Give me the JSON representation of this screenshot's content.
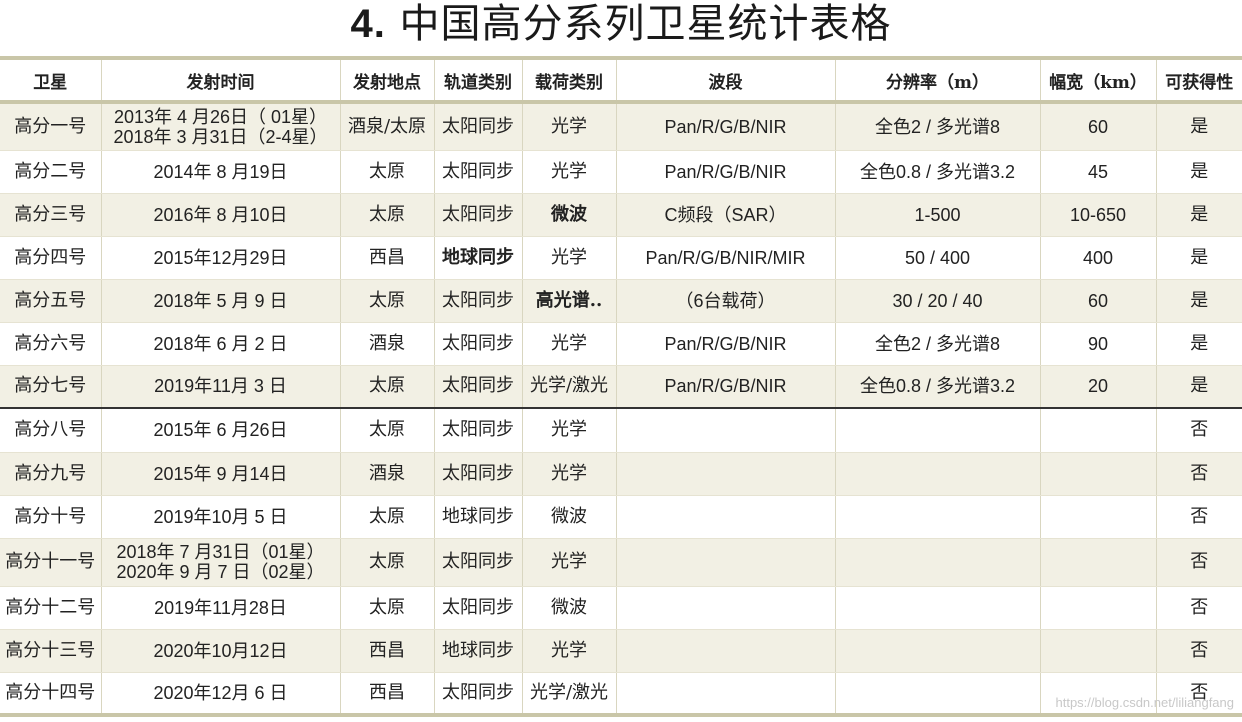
{
  "title_num": "4.",
  "title_text": "中国高分系列卫星统计表格",
  "headers": [
    "卫星",
    "发射时间",
    "发射地点",
    "轨道类别",
    "载荷类别",
    "波段",
    "分辨率（m）",
    "幅宽（km）",
    "可获得性"
  ],
  "rows": [
    {
      "name": "高分一号",
      "date": [
        "2013年 4 月26日（ 01星）",
        "2018年 3 月31日（2-4星）"
      ],
      "site": "酒泉/太原",
      "orbit": "太阳同步",
      "payload": "光学",
      "band": "Pan/R/G/B/NIR",
      "res": "全色2 / 多光谱8",
      "width": "60",
      "avail": "是"
    },
    {
      "name": "高分二号",
      "date": [
        "2014年 8 月19日"
      ],
      "site": "太原",
      "orbit": "太阳同步",
      "payload": "光学",
      "band": "Pan/R/G/B/NIR",
      "res": "全色0.8 / 多光谱3.2",
      "width": "45",
      "avail": "是"
    },
    {
      "name": "高分三号",
      "date": [
        "2016年 8 月10日"
      ],
      "site": "太原",
      "orbit": "太阳同步",
      "payload": "微波",
      "band": "C频段（SAR）",
      "res": "1-500",
      "width": "10-650",
      "avail": "是"
    },
    {
      "name": "高分四号",
      "date": [
        "2015年12月29日"
      ],
      "site": "西昌",
      "orbit": "地球同步",
      "payload": "光学",
      "band": "Pan/R/G/B/NIR/MIR",
      "res": "50 / 400",
      "width": "400",
      "avail": "是"
    },
    {
      "name": "高分五号",
      "date": [
        "2018年 5 月 9 日"
      ],
      "site": "太原",
      "orbit": "太阳同步",
      "payload": "高光谱..",
      "band": "（6台载荷）",
      "res": "30 / 20 / 40",
      "width": "60",
      "avail": "是"
    },
    {
      "name": "高分六号",
      "date": [
        "2018年 6 月 2 日"
      ],
      "site": "酒泉",
      "orbit": "太阳同步",
      "payload": "光学",
      "band": "Pan/R/G/B/NIR",
      "res": "全色2 / 多光谱8",
      "width": "90",
      "avail": "是"
    },
    {
      "name": "高分七号",
      "date": [
        "2019年11月 3 日"
      ],
      "site": "太原",
      "orbit": "太阳同步",
      "payload": "光学/激光",
      "band": "Pan/R/G/B/NIR",
      "res": "全色0.8 / 多光谱3.2",
      "width": "20",
      "avail": "是"
    },
    {
      "name": "高分八号",
      "date": [
        "2015年 6 月26日"
      ],
      "site": "太原",
      "orbit": "太阳同步",
      "payload": "光学",
      "band": "",
      "res": "",
      "width": "",
      "avail": "否"
    },
    {
      "name": "高分九号",
      "date": [
        "2015年 9 月14日"
      ],
      "site": "酒泉",
      "orbit": "太阳同步",
      "payload": "光学",
      "band": "",
      "res": "",
      "width": "",
      "avail": "否"
    },
    {
      "name": "高分十号",
      "date": [
        "2019年10月 5 日"
      ],
      "site": "太原",
      "orbit": "地球同步",
      "payload": "微波",
      "band": "",
      "res": "",
      "width": "",
      "avail": "否"
    },
    {
      "name": "高分十一号",
      "date": [
        "2018年 7 月31日（01星）",
        "2020年 9 月 7 日（02星）"
      ],
      "site": "太原",
      "orbit": "太阳同步",
      "payload": "光学",
      "band": "",
      "res": "",
      "width": "",
      "avail": "否"
    },
    {
      "name": "高分十二号",
      "date": [
        "2019年11月28日"
      ],
      "site": "太原",
      "orbit": "太阳同步",
      "payload": "微波",
      "band": "",
      "res": "",
      "width": "",
      "avail": "否"
    },
    {
      "name": "高分十三号",
      "date": [
        "2020年10月12日"
      ],
      "site": "西昌",
      "orbit": "地球同步",
      "payload": "光学",
      "band": "",
      "res": "",
      "width": "",
      "avail": "否"
    },
    {
      "name": "高分十四号",
      "date": [
        "2020年12月 6 日"
      ],
      "site": "西昌",
      "orbit": "太阳同步",
      "payload": "光学/激光",
      "band": "",
      "res": "",
      "width": "",
      "avail": "否"
    }
  ],
  "watermark": "https://blog.csdn.net/liliangfang"
}
